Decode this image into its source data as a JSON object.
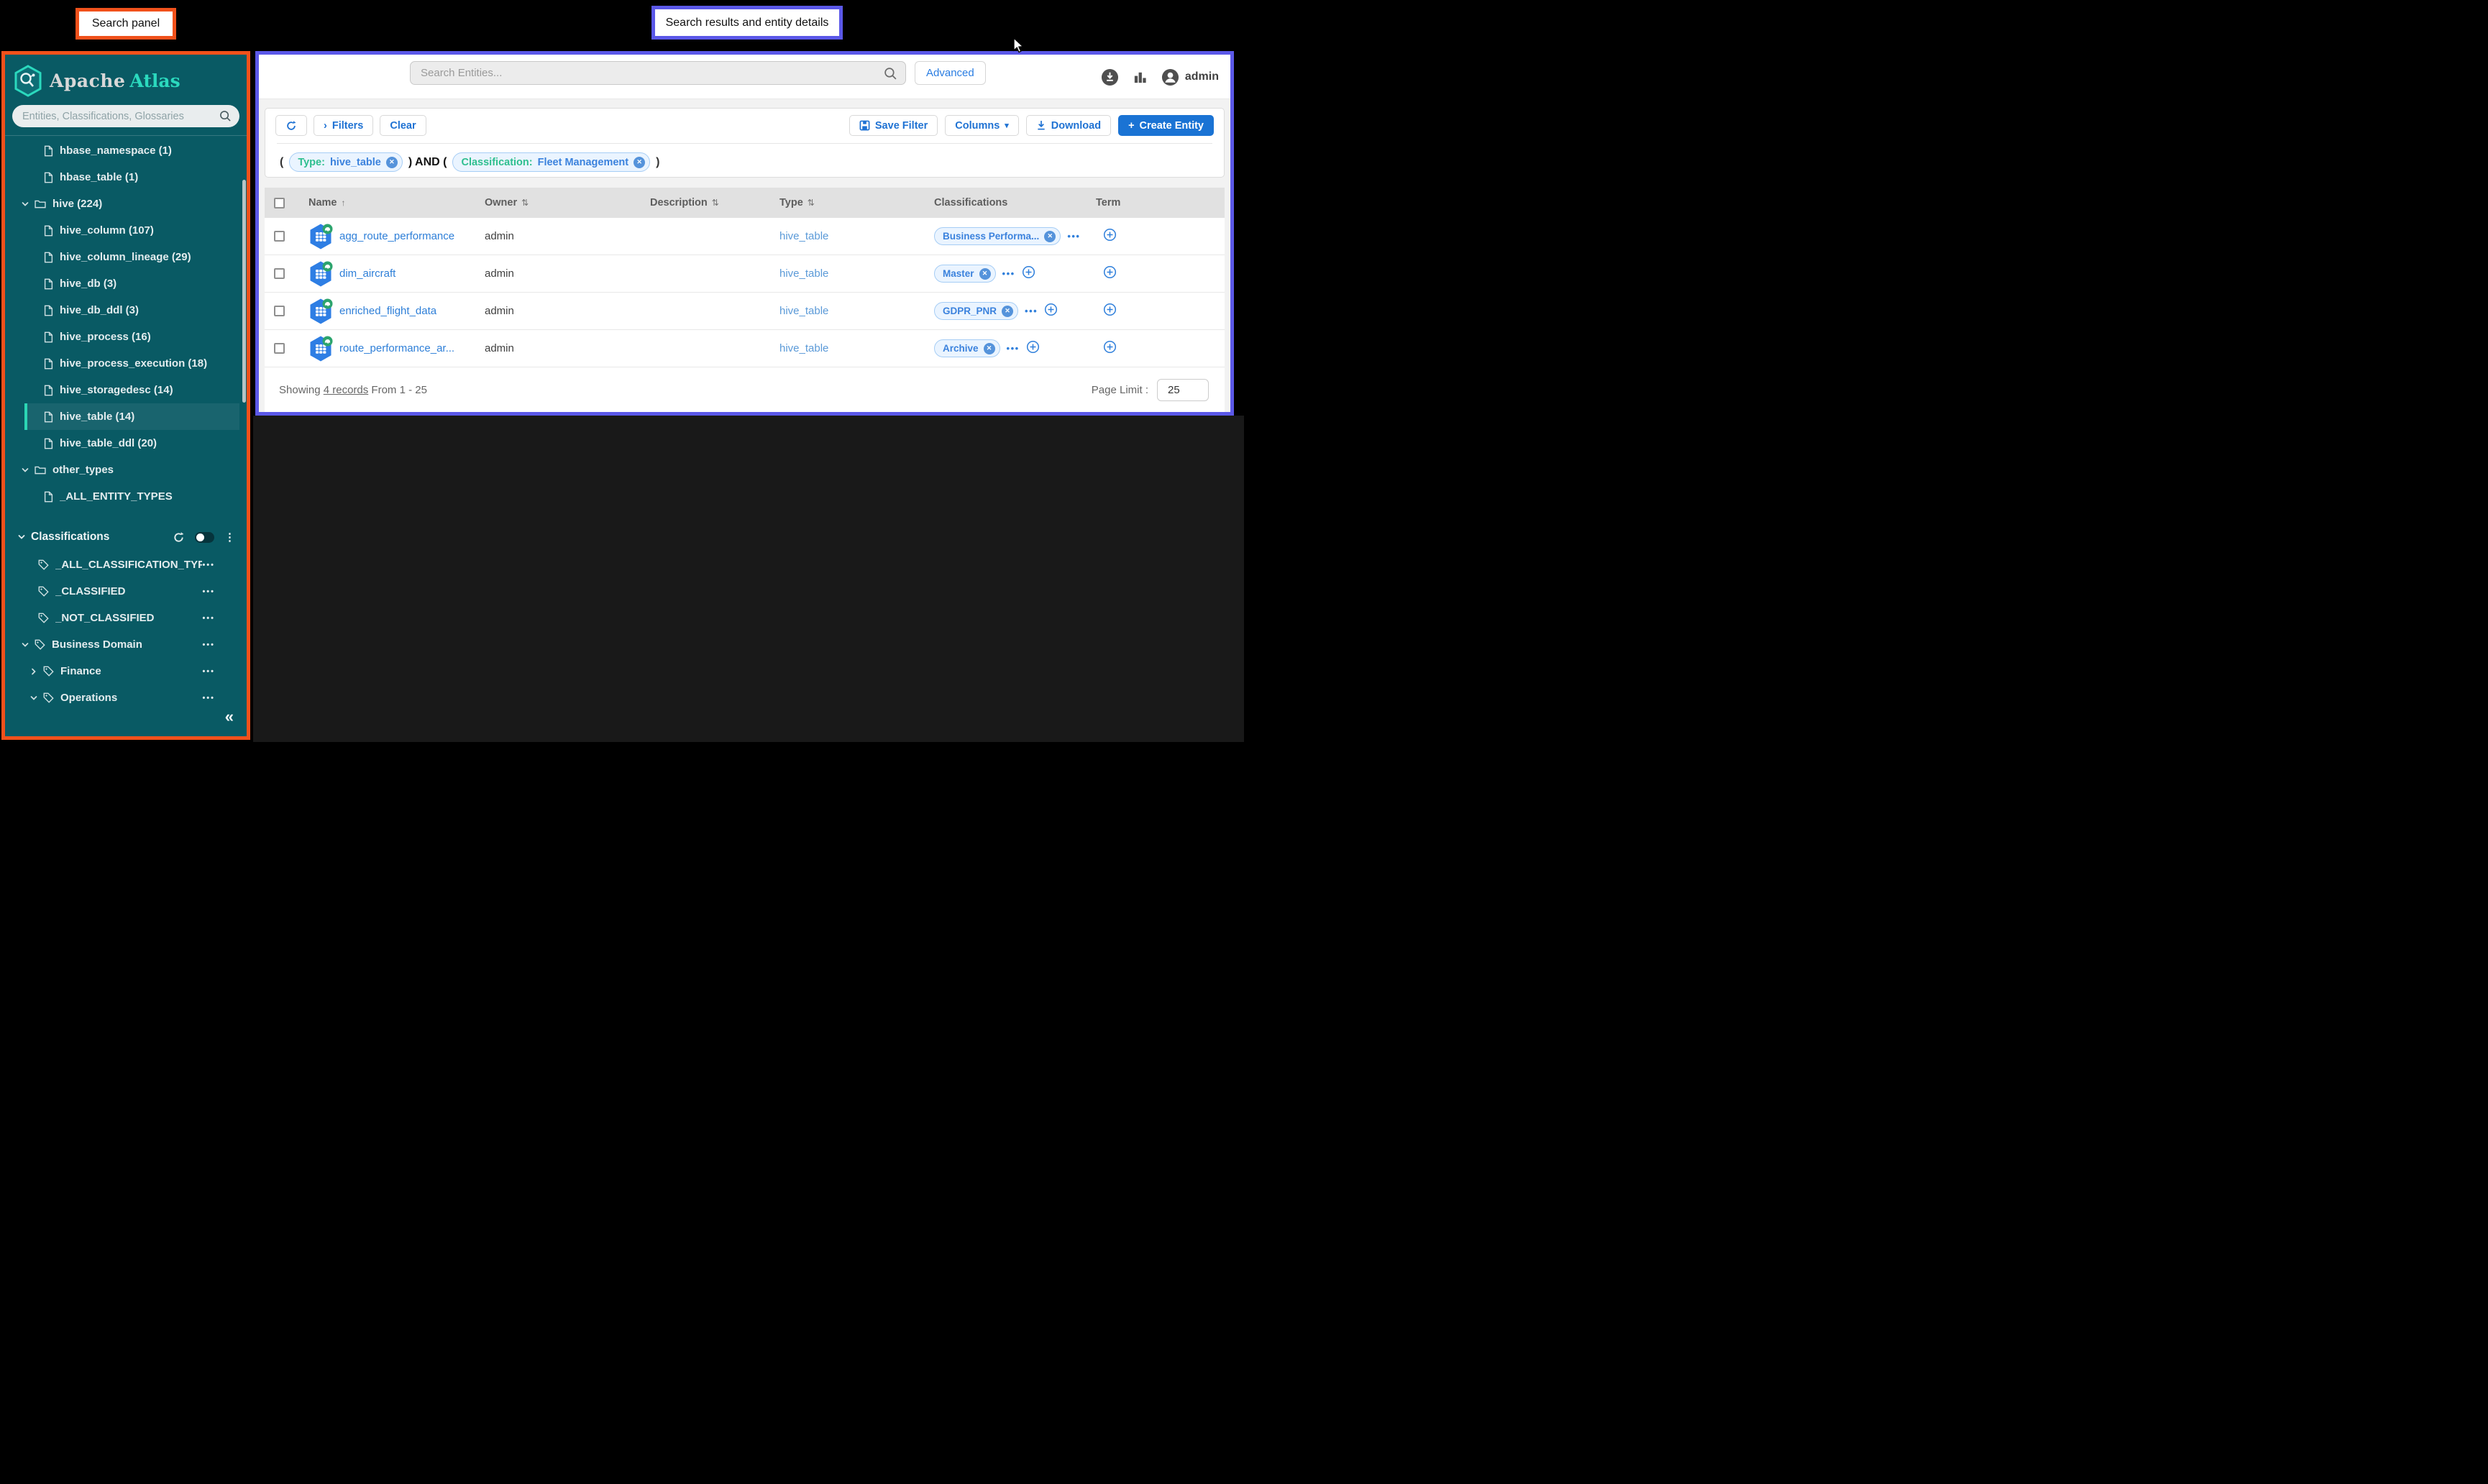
{
  "callouts": {
    "left": "Search panel",
    "right": "Search results and entity details"
  },
  "sidebar": {
    "logo_apache": "Apache",
    "logo_atlas": "Atlas",
    "search_placeholder": "Entities, Classifications, Glossaries",
    "entity_tree": [
      {
        "label": "hbase_namespace (1)",
        "icon": "doc",
        "chevron": null,
        "indent": 2,
        "selected": false
      },
      {
        "label": "hbase_table (1)",
        "icon": "doc",
        "chevron": null,
        "indent": 2,
        "selected": false
      },
      {
        "label": "hive (224)",
        "icon": "folder",
        "chevron": "down",
        "indent": 1,
        "selected": false
      },
      {
        "label": "hive_column (107)",
        "icon": "doc",
        "chevron": null,
        "indent": 2,
        "selected": false
      },
      {
        "label": "hive_column_lineage (29)",
        "icon": "doc",
        "chevron": null,
        "indent": 2,
        "selected": false
      },
      {
        "label": "hive_db (3)",
        "icon": "doc",
        "chevron": null,
        "indent": 2,
        "selected": false
      },
      {
        "label": "hive_db_ddl (3)",
        "icon": "doc",
        "chevron": null,
        "indent": 2,
        "selected": false
      },
      {
        "label": "hive_process (16)",
        "icon": "doc",
        "chevron": null,
        "indent": 2,
        "selected": false
      },
      {
        "label": "hive_process_execution (18)",
        "icon": "doc",
        "chevron": null,
        "indent": 2,
        "selected": false
      },
      {
        "label": "hive_storagedesc (14)",
        "icon": "doc",
        "chevron": null,
        "indent": 2,
        "selected": false
      },
      {
        "label": "hive_table (14)",
        "icon": "doc",
        "chevron": null,
        "indent": 2,
        "selected": true
      },
      {
        "label": "hive_table_ddl (20)",
        "icon": "doc",
        "chevron": null,
        "indent": 2,
        "selected": false
      },
      {
        "label": "other_types",
        "icon": "folder",
        "chevron": "down",
        "indent": 1,
        "selected": false
      },
      {
        "label": "_ALL_ENTITY_TYPES",
        "icon": "doc",
        "chevron": null,
        "indent": 2,
        "selected": false
      }
    ],
    "classifications_header": "Classifications",
    "classification_tree": [
      {
        "label": "_ALL_CLASSIFICATION_TYPES",
        "icon": "tag",
        "chevron": null,
        "indent": 1,
        "menu": true
      },
      {
        "label": "_CLASSIFIED",
        "icon": "tag",
        "chevron": null,
        "indent": 1,
        "menu": true
      },
      {
        "label": "_NOT_CLASSIFIED",
        "icon": "tag",
        "chevron": null,
        "indent": 1,
        "menu": true
      },
      {
        "label": "Business Domain",
        "icon": "tag",
        "chevron": "down",
        "indent": 1,
        "menu": true
      },
      {
        "label": "Finance",
        "icon": "tag",
        "chevron": "right",
        "indent": 2,
        "menu": true
      },
      {
        "label": "Operations",
        "icon": "tag",
        "chevron": "down",
        "indent": 2,
        "menu": true
      }
    ],
    "menu_dots": "•••",
    "collapse_icon": "«"
  },
  "header": {
    "search_placeholder": "Search Entities...",
    "advanced_label": "Advanced",
    "username": "admin"
  },
  "toolbar": {
    "filters_chevron": "›",
    "filters_label": "Filters",
    "clear_label": "Clear",
    "save_filter_label": "Save Filter",
    "columns_label": "Columns",
    "columns_caret": "▾",
    "download_label": "Download",
    "create_plus": "+",
    "create_entity_label": "Create Entity"
  },
  "query": {
    "open": "(",
    "chip1_key": "Type:",
    "chip1_value": "hive_table",
    "middle": ") AND (",
    "chip2_key": "Classification:",
    "chip2_value": "Fleet Management",
    "close": ")"
  },
  "table": {
    "columns": [
      {
        "label": "Name",
        "sort": "↑"
      },
      {
        "label": "Owner",
        "sort": "⇅"
      },
      {
        "label": "Description",
        "sort": "⇅"
      },
      {
        "label": "Type",
        "sort": "⇅"
      },
      {
        "label": "Classifications",
        "sort": ""
      },
      {
        "label": "Term",
        "sort": ""
      }
    ],
    "rows": [
      {
        "name": "agg_route_performance",
        "owner": "admin",
        "description": "",
        "type": "hive_table",
        "classification": "Business Performa...",
        "has_add_classification": false
      },
      {
        "name": "dim_aircraft",
        "owner": "admin",
        "description": "",
        "type": "hive_table",
        "classification": "Master",
        "has_add_classification": true
      },
      {
        "name": "enriched_flight_data",
        "owner": "admin",
        "description": "",
        "type": "hive_table",
        "classification": "GDPR_PNR",
        "has_add_classification": true
      },
      {
        "name": "route_performance_ar...",
        "owner": "admin",
        "description": "",
        "type": "hive_table",
        "classification": "Archive",
        "has_add_classification": true
      }
    ]
  },
  "footer": {
    "showing_prefix": "Showing",
    "records_link": "4 records",
    "showing_suffix": "From 1 - 25",
    "page_limit_label": "Page Limit :",
    "page_limit_value": "25"
  },
  "colors": {
    "sidebar_teal": "#095A64",
    "accent_turquoise": "#2BD6B4",
    "callout_orange": "#F1511B",
    "callout_purple": "#5B58E8",
    "action_blue": "#1F72D3",
    "create_entity_blue": "#1A73D4",
    "chip_key_green": "#2FBF8F",
    "chip_value_blue": "#3B82DD"
  }
}
